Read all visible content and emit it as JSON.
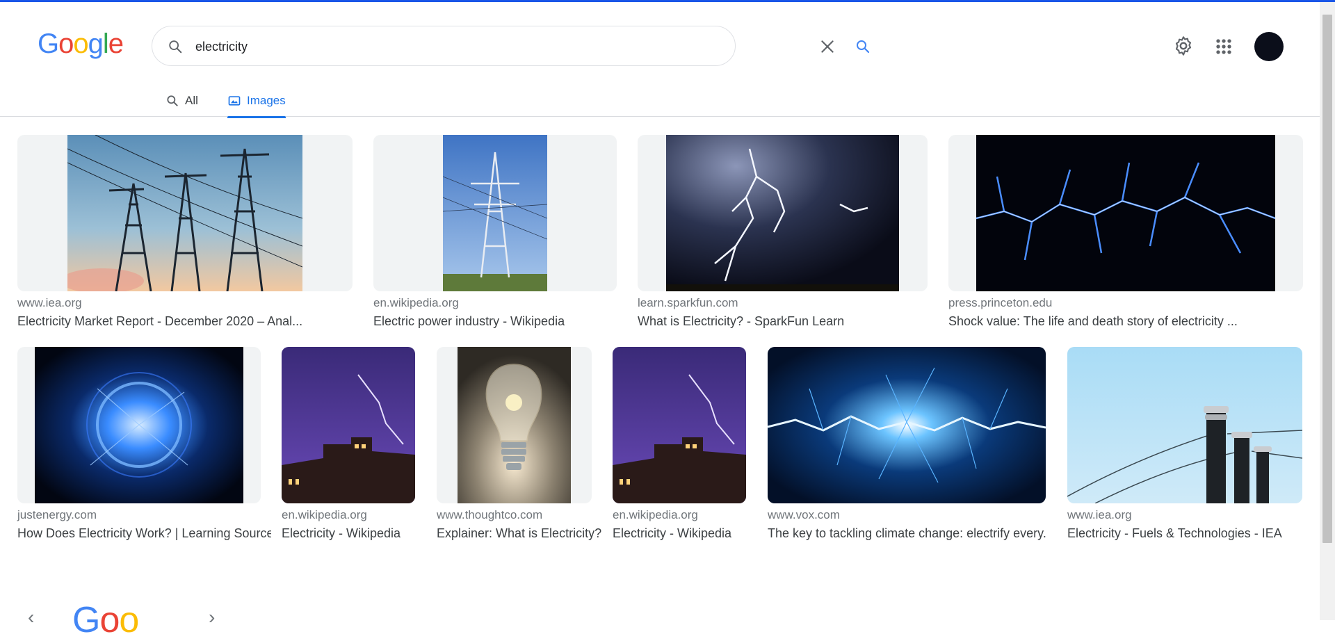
{
  "logo": {
    "letters": [
      "G",
      "o",
      "o",
      "g",
      "l",
      "e"
    ],
    "colors": [
      "#4285f4",
      "#ea4335",
      "#fbbc05",
      "#4285f4",
      "#34a853",
      "#ea4335"
    ]
  },
  "search": {
    "query": "electricity",
    "placeholder": ""
  },
  "header_icons": [
    "settings-icon",
    "apps-icon",
    "account-avatar"
  ],
  "tabs": [
    {
      "label": "All",
      "icon": "search-icon",
      "active": false
    },
    {
      "label": "Images",
      "icon": "image-icon",
      "active": true
    }
  ],
  "results": [
    {
      "source": "www.iea.org",
      "title": "Electricity Market Report - December 2020 – Anal...",
      "image": "power-pylons-sunset"
    },
    {
      "source": "en.wikipedia.org",
      "title": "Electric power industry - Wikipedia",
      "image": "transmission-tower-blue-sky"
    },
    {
      "source": "learn.sparkfun.com",
      "title": "What is Electricity? - SparkFun Learn",
      "image": "lightning-storm"
    },
    {
      "source": "press.princeton.edu",
      "title": "Shock value: The life and death story of electricity ...",
      "image": "blue-electric-arcs"
    },
    {
      "source": "justenergy.com",
      "title": "How Does Electricity Work? | Learning Source",
      "image": "plasma-energy-ball"
    },
    {
      "source": "en.wikipedia.org",
      "title": "Electricity - Wikipedia",
      "image": "lightning-over-building"
    },
    {
      "source": "www.thoughtco.com",
      "title": "Explainer: What is Electricity?",
      "image": "light-bulb"
    },
    {
      "source": "en.wikipedia.org",
      "title": "Electricity - Wikipedia",
      "image": "lightning-over-building"
    },
    {
      "source": "www.vox.com",
      "title": "The key to tackling climate change: electrify every...",
      "image": "electric-discharge"
    },
    {
      "source": "www.iea.org",
      "title": "Electricity - Fuels & Technologies - IEA",
      "image": "insulators-power-lines"
    }
  ],
  "footer": {
    "logo_text": "Goo",
    "prev_arrow": "‹",
    "next_arrow": "›"
  }
}
